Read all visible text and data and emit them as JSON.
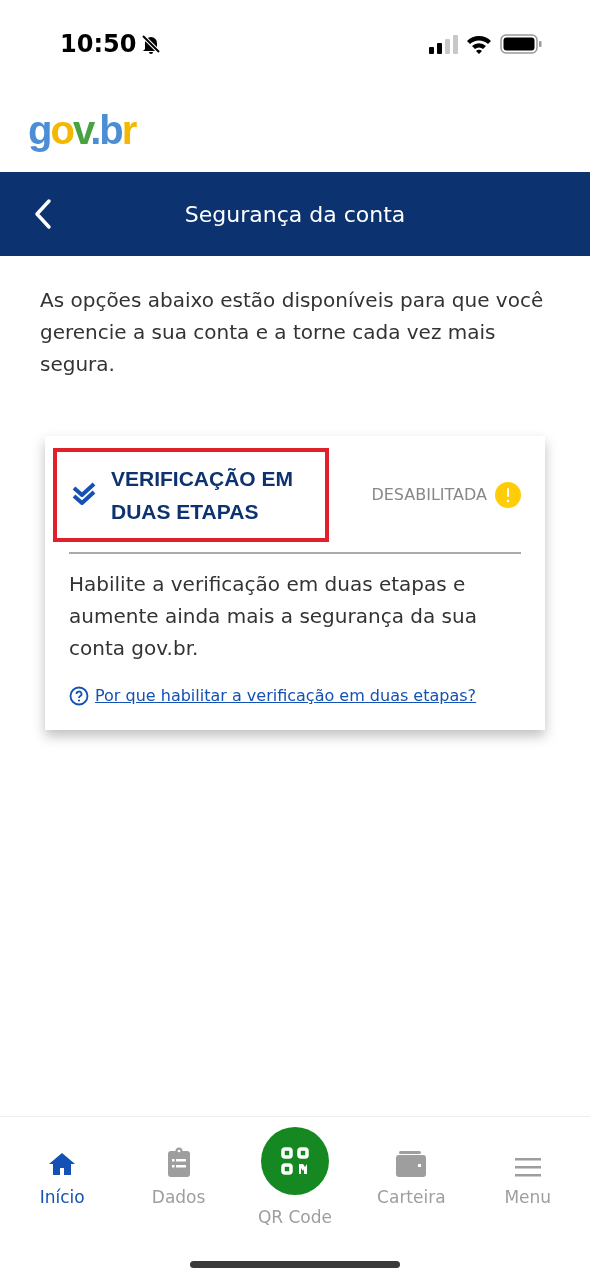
{
  "status_bar": {
    "time": "10:50",
    "silent": true
  },
  "logo": "gov.br",
  "header": {
    "title": "Segurança da conta"
  },
  "intro": "As opções abaixo estão disponíveis para que você gerencie a sua conta e a torne cada vez mais segura.",
  "card": {
    "title": "VERIFICAÇÃO EM DUAS ETAPAS",
    "highlighted": true,
    "status": "DESABILITADA",
    "enabled": false,
    "description": "Habilite a verificação em duas etapas e aumente ainda mais a segurança da sua conta gov.br.",
    "link": "Por que habilitar a verificação em duas etapas?"
  },
  "nav": [
    {
      "label": "Início",
      "kind": "home",
      "selected": true
    },
    {
      "label": "Dados",
      "kind": "clipboard",
      "selected": false
    },
    {
      "label": "QR Code",
      "kind": "qr",
      "selected": false
    },
    {
      "label": "Carteira",
      "kind": "wallet",
      "selected": false
    },
    {
      "label": "Menu",
      "kind": "menu",
      "selected": false
    }
  ]
}
